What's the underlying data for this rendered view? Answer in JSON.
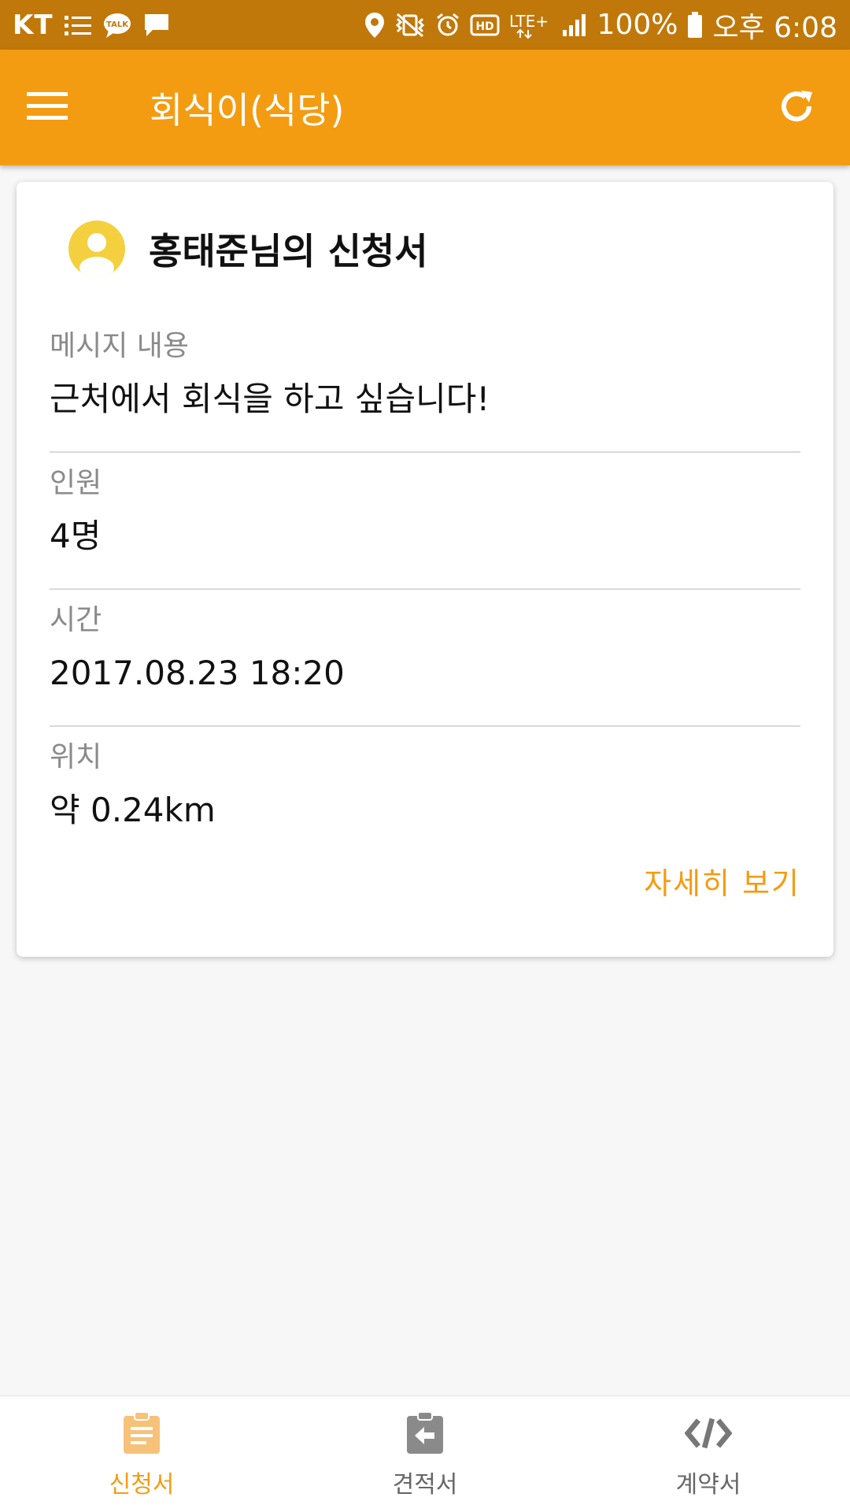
{
  "status_bar": {
    "carrier": "KT",
    "battery": "100%",
    "time": "오후 6:08",
    "network": "LTE+",
    "icons": [
      "list-icon",
      "talk-icon",
      "message-icon",
      "location-icon",
      "vibrate-icon",
      "alarm-icon",
      "hd-icon",
      "lte-icon",
      "signal-icon",
      "battery-icon"
    ]
  },
  "app_bar": {
    "title": "회식이(식당)",
    "icons": [
      "menu-icon",
      "refresh-icon"
    ]
  },
  "card": {
    "title": "홍태준님의 신청서",
    "fields": [
      {
        "label": "메시지 내용",
        "value": "근처에서 회식을 하고 싶습니다!"
      },
      {
        "label": "인원",
        "value": "4명"
      },
      {
        "label": "시간",
        "value": "2017.08.23 18:20"
      },
      {
        "label": "위치",
        "value": "약 0.24km"
      }
    ],
    "detail_link": "자세히 보기"
  },
  "bottom_nav": {
    "items": [
      {
        "label": "신청서",
        "icon": "clipboard-icon",
        "active": true
      },
      {
        "label": "견적서",
        "icon": "clipboard-arrow-icon",
        "active": false
      },
      {
        "label": "계약서",
        "icon": "code-icon",
        "active": false
      }
    ]
  },
  "colors": {
    "accent": "#f39c12",
    "status_bar": "#c0780a",
    "avatar": "#f4d03f",
    "background": "#f7f7f7"
  }
}
